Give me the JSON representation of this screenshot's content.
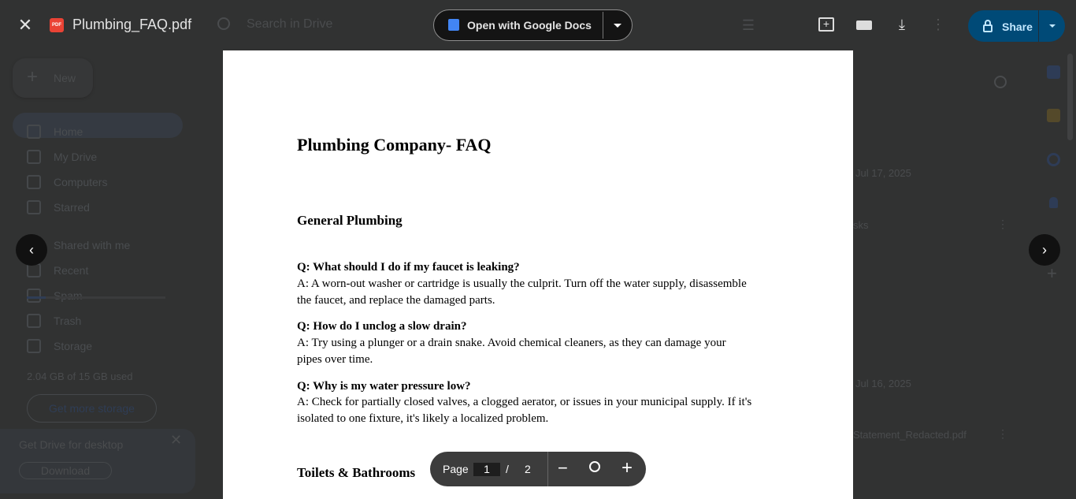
{
  "viewer": {
    "file_name": "Plumbing_FAQ.pdf",
    "file_badge": "PDF",
    "open_with_label": "Open with Google Docs",
    "share_label": "Share",
    "page_label": "Page",
    "current_page": "1",
    "page_separator": "/",
    "total_pages": "2"
  },
  "background": {
    "search_placeholder": "Search in Drive",
    "new_label": "New",
    "sidebar": [
      {
        "label": "Home",
        "icon": "home-icon"
      },
      {
        "label": "My Drive",
        "icon": "drive-icon"
      },
      {
        "label": "Computers",
        "icon": "computer-icon"
      },
      {
        "label": "Starred",
        "icon": "star-icon"
      },
      {
        "label": "Shared with me",
        "icon": "people-icon"
      },
      {
        "label": "Recent",
        "icon": "clock-icon"
      },
      {
        "label": "Spam",
        "icon": "spam-icon"
      },
      {
        "label": "Trash",
        "icon": "trash-icon"
      },
      {
        "label": "Storage",
        "icon": "cloud-icon"
      }
    ],
    "storage_used": "2.04 GB of 15 GB used",
    "storage_fraction": 0.136,
    "get_storage_label": "Get more storage",
    "promo_title": "Get Drive for desktop",
    "promo_button": "Download",
    "date1": "Jul 17, 2025",
    "file1": "sks",
    "date2": "Jul 16, 2025",
    "file2": "Statement_Redacted.pdf"
  },
  "document": {
    "title": "Plumbing Company- FAQ",
    "section1": "General Plumbing",
    "q1": "Q: What should I do if my faucet is leaking?",
    "a1_l1": " A: A worn-out washer or cartridge is usually the culprit. Turn off the water supply, disassemble",
    "a1_l2": "the faucet, and replace the damaged parts.",
    "q2": "Q: How do I unclog a slow drain?",
    "a2_l1": " A: Try using a plunger or a drain snake. Avoid chemical cleaners, as they can damage your",
    "a2_l2": "pipes over time.",
    "q3": "Q: Why is my water pressure low?",
    "a3_l1": " A: Check for partially closed valves, a clogged aerator, or issues in your municipal supply. If it's",
    "a3_l2": "isolated to one fixture, it's likely a localized problem.",
    "section2": "Toilets & Bathrooms"
  },
  "colors": {
    "share": "#0b57d0",
    "docs": "#4285f4",
    "pdf": "#ea4335"
  }
}
